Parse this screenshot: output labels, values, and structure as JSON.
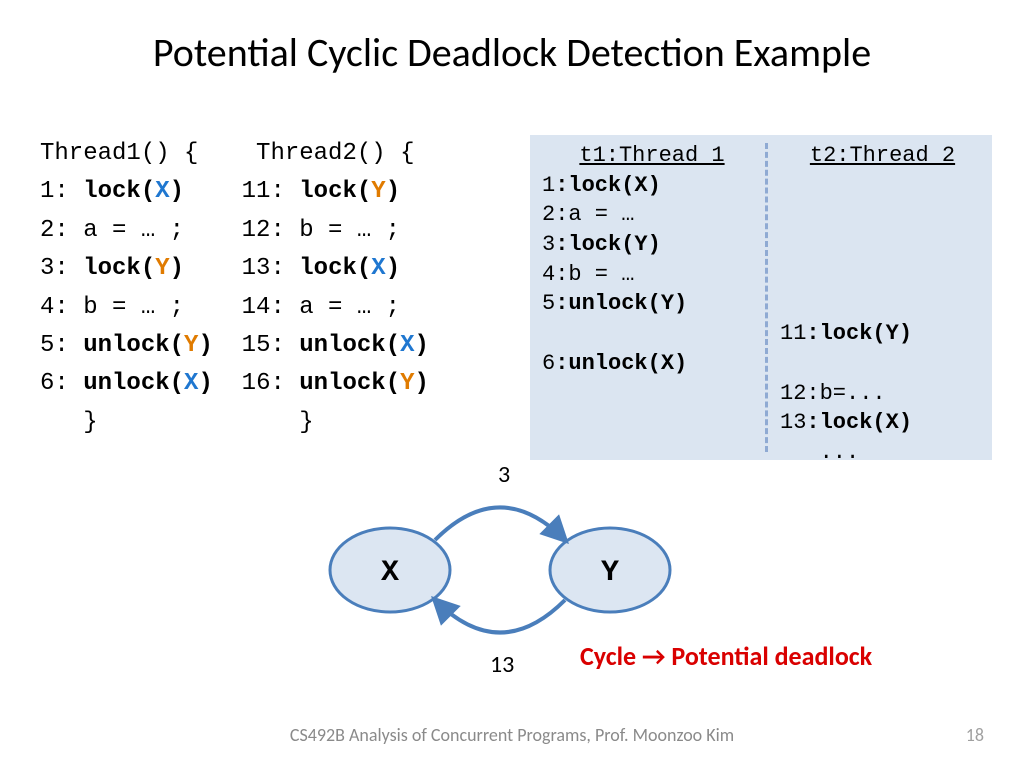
{
  "title": "Potential Cyclic Deadlock Detection Example",
  "code": {
    "t1_sig": "Thread1() {",
    "t1_1_n": "1: ",
    "t1_1_a": "lock(",
    "t1_1_v": "X",
    "t1_1_z": ")",
    "t1_2": "2: a = … ;",
    "t1_3_n": "3: ",
    "t1_3_a": "lock(",
    "t1_3_v": "Y",
    "t1_3_z": ")",
    "t1_4": "4: b = … ;",
    "t1_5_n": "5: ",
    "t1_5_a": "unlock(",
    "t1_5_v": "Y",
    "t1_5_z": ")",
    "t1_6_n": "6: ",
    "t1_6_a": "unlock(",
    "t1_6_v": "X",
    "t1_6_z": ")",
    "t1_end": "   }",
    "t2_sig": "Thread2() {",
    "t2_11_n": "11: ",
    "t2_11_a": "lock(",
    "t2_11_v": "Y",
    "t2_11_z": ")",
    "t2_12": "12: b = … ;",
    "t2_13_n": "13: ",
    "t2_13_a": "lock(",
    "t2_13_v": "X",
    "t2_13_z": ")",
    "t2_14": "14: a = … ;",
    "t2_15_n": "15: ",
    "t2_15_a": "unlock(",
    "t2_15_v": "X",
    "t2_15_z": ")",
    "t2_16_n": "16: ",
    "t2_16_a": "unlock(",
    "t2_16_v": "Y",
    "t2_16_z": ")",
    "t2_end": "   }"
  },
  "trace": {
    "head1": "t1:Thread 1",
    "head2": "t2:Thread 2",
    "l1_n": "1",
    "l1_b": ":lock(X)",
    "l2_n": "2",
    "l2_t": ":a = …",
    "l3_n": "3",
    "l3_b": ":lock(Y)",
    "l4_n": "4",
    "l4_t": ":b = …",
    "l5_n": "5",
    "l5_b": ":unlock(Y)",
    "l6_n": "6",
    "l6_b": ":unlock(X)",
    "r11_n": "11",
    "r11_b": ":lock(Y)",
    "r12_n": "12",
    "r12_t": ":b=...",
    "r13_n": "13",
    "r13_b": ":lock(X)",
    "rdots": "   ..."
  },
  "graph": {
    "nodeX": "X",
    "nodeY": "Y",
    "top_label": "3",
    "bot_label": "13"
  },
  "cycle_note": "Cycle → Potential deadlock",
  "footer": "CS492B Analysis of Concurrent Programs, Prof. Moonzoo Kim",
  "pagenum": "18"
}
